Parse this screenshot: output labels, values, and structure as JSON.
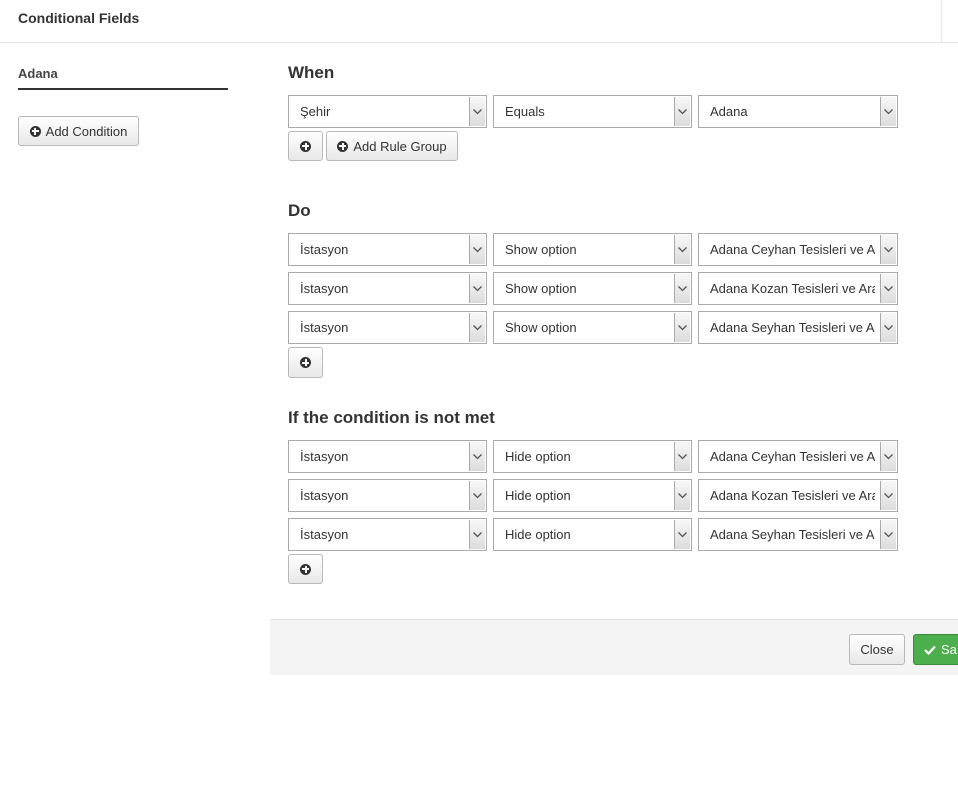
{
  "header": {
    "title": "Conditional Fields"
  },
  "sidebar": {
    "tab_label": "Adana",
    "add_condition_label": "Add Condition"
  },
  "when": {
    "title": "When",
    "rule": {
      "field": "Şehir",
      "operator": "Equals",
      "value": "Adana"
    },
    "add_rule_group_label": "Add Rule Group"
  },
  "do": {
    "title": "Do",
    "rows": [
      {
        "field": "İstasyon",
        "action": "Show option",
        "option": "Adana Ceyhan Tesisleri ve Ar"
      },
      {
        "field": "İstasyon",
        "action": "Show option",
        "option": "Adana Kozan Tesisleri ve Ara"
      },
      {
        "field": "İstasyon",
        "action": "Show option",
        "option": "Adana Seyhan Tesisleri ve Ar"
      }
    ]
  },
  "else": {
    "title": "If the condition is not met",
    "rows": [
      {
        "field": "İstasyon",
        "action": "Hide option",
        "option": "Adana Ceyhan Tesisleri ve Ar"
      },
      {
        "field": "İstasyon",
        "action": "Hide option",
        "option": "Adana Kozan Tesisleri ve Ara"
      },
      {
        "field": "İstasyon",
        "action": "Hide option",
        "option": "Adana Seyhan Tesisleri ve Ar"
      }
    ]
  },
  "footer": {
    "close_label": "Close",
    "save_label": "Sa"
  },
  "colors": {
    "save": "#4cae4c",
    "footer_bg": "#f4f4f4"
  }
}
